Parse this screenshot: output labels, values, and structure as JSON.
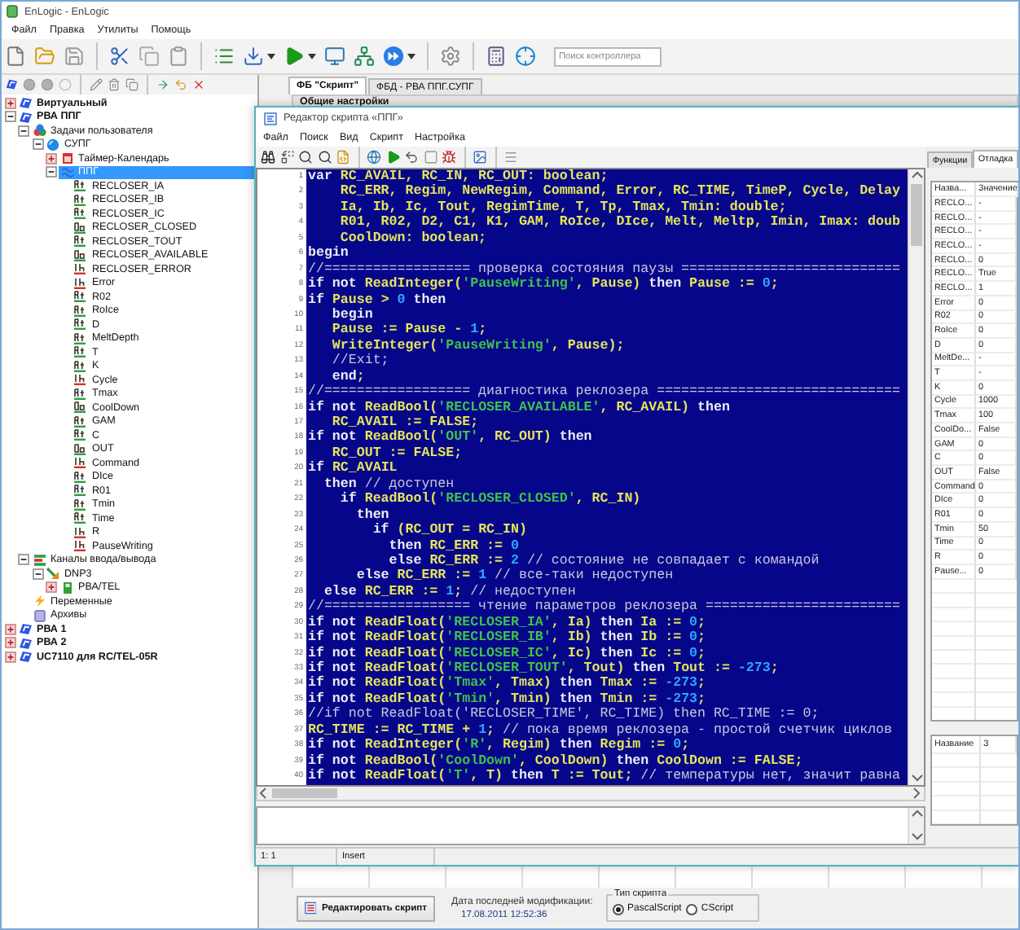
{
  "window": {
    "title": "EnLogic - EnLogic"
  },
  "menu": [
    "Файл",
    "Правка",
    "Утилиты",
    "Помощь"
  ],
  "toolbar": {
    "search": {
      "placeholder": "Поиск контроллера"
    }
  },
  "tree": [
    {
      "label": "Виртуальный",
      "kind": "controller",
      "expanded": false,
      "selected": false
    },
    {
      "label": "РВА ППГ",
      "kind": "controller",
      "expanded": true,
      "selected": false,
      "children": [
        {
          "label": "Задачи пользователя",
          "kind": "tasks",
          "expanded": true,
          "selected": false,
          "children": [
            {
              "label": "СУПГ",
              "kind": "group",
              "expanded": true,
              "selected": false,
              "children": [
                {
                  "label": "Таймер-Календарь",
                  "kind": "timer",
                  "expanded": false,
                  "selected": false
                },
                {
                  "label": "ППГ",
                  "kind": "script",
                  "expanded": true,
                  "selected": true,
                  "children": [
                    {
                      "label": "RECLOSER_IA",
                      "kind": "real",
                      "selected": false
                    },
                    {
                      "label": "RECLOSER_IB",
                      "kind": "real",
                      "selected": false
                    },
                    {
                      "label": "RECLOSER_IC",
                      "kind": "real",
                      "selected": false
                    },
                    {
                      "label": "RECLOSER_CLOSED",
                      "kind": "bool",
                      "selected": false
                    },
                    {
                      "label": "RECLOSER_TOUT",
                      "kind": "real",
                      "selected": false
                    },
                    {
                      "label": "RECLOSER_AVAILABLE",
                      "kind": "bool",
                      "selected": false
                    },
                    {
                      "label": "RECLOSER_ERROR",
                      "kind": "int",
                      "selected": false
                    },
                    {
                      "label": "Error",
                      "kind": "int",
                      "selected": false
                    },
                    {
                      "label": "R02",
                      "kind": "real",
                      "selected": false
                    },
                    {
                      "label": "RoIce",
                      "kind": "real",
                      "selected": false
                    },
                    {
                      "label": "D",
                      "kind": "real",
                      "selected": false
                    },
                    {
                      "label": "MeltDepth",
                      "kind": "real",
                      "selected": false
                    },
                    {
                      "label": "T",
                      "kind": "real",
                      "selected": false
                    },
                    {
                      "label": "K",
                      "kind": "real",
                      "selected": false
                    },
                    {
                      "label": "Cycle",
                      "kind": "int",
                      "selected": false
                    },
                    {
                      "label": "Tmax",
                      "kind": "real",
                      "selected": false
                    },
                    {
                      "label": "CoolDown",
                      "kind": "bool",
                      "selected": false
                    },
                    {
                      "label": "GAM",
                      "kind": "real",
                      "selected": false
                    },
                    {
                      "label": "C",
                      "kind": "real",
                      "selected": false
                    },
                    {
                      "label": "OUT",
                      "kind": "bool",
                      "selected": false
                    },
                    {
                      "label": "Command",
                      "kind": "int",
                      "selected": false
                    },
                    {
                      "label": "DIce",
                      "kind": "real",
                      "selected": false
                    },
                    {
                      "label": "R01",
                      "kind": "real",
                      "selected": false
                    },
                    {
                      "label": "Tmin",
                      "kind": "real",
                      "selected": false
                    },
                    {
                      "label": "Time",
                      "kind": "real",
                      "selected": false
                    },
                    {
                      "label": "R",
                      "kind": "int",
                      "selected": false
                    },
                    {
                      "label": "PauseWriting",
                      "kind": "int",
                      "selected": false
                    }
                  ]
                }
              ]
            }
          ]
        },
        {
          "label": "Каналы ввода/вывода",
          "kind": "channels",
          "expanded": true,
          "selected": false,
          "children": [
            {
              "label": "DNP3",
              "kind": "protocol",
              "expanded": true,
              "selected": false,
              "children": [
                {
                  "label": "РВА/TEL",
                  "kind": "device",
                  "expanded": false,
                  "selected": false
                }
              ]
            }
          ]
        },
        {
          "label": "Переменные",
          "kind": "variables",
          "selected": false
        },
        {
          "label": "Архивы",
          "kind": "archives",
          "selected": false
        }
      ]
    },
    {
      "label": "РВА 1",
      "kind": "controller",
      "expanded": false,
      "selected": false
    },
    {
      "label": "РВА 2",
      "kind": "controller",
      "expanded": false,
      "selected": false
    },
    {
      "label": "UC7110 для RC/TEL-05R",
      "kind": "controller",
      "expanded": false,
      "selected": false
    }
  ],
  "tabs": [
    {
      "label": "ФБ \"Скрипт\"",
      "selected": true
    },
    {
      "label": "ФБД - РВА ППГ.СУПГ",
      "selected": false
    }
  ],
  "section": {
    "title": "Общие настройки"
  },
  "editor": {
    "title": "Редактор скрипта «ППГ»",
    "menu": [
      "Файл",
      "Поиск",
      "Вид",
      "Скрипт",
      "Настройка"
    ],
    "code_lines": [
      {
        "number": "1",
        "tokens": [
          {
            "kind": "kw",
            "text": "var"
          },
          {
            "kind": "id",
            "text": " RC_AVAIL, RC_IN, RC_OUT: boolean;"
          }
        ]
      },
      {
        "number": "2",
        "tokens": [
          {
            "kind": "id",
            "text": "    RC_ERR, Regim, NewRegim, Command, Error, RC_TIME, TimeP, Cycle, Delay"
          }
        ]
      },
      {
        "number": "3",
        "tokens": [
          {
            "kind": "id",
            "text": "    Ia, Ib, Ic, Tout, RegimTime, T, Tp, Tmax, Tmin: double;"
          }
        ]
      },
      {
        "number": "4",
        "tokens": [
          {
            "kind": "id",
            "text": "    R01, R02, D2, C1, K1, GAM, RoIce, DIce, Melt, Meltp, Imin, Imax: doub"
          }
        ]
      },
      {
        "number": "5",
        "tokens": [
          {
            "kind": "id",
            "text": "    CoolDown: boolean;"
          }
        ]
      },
      {
        "number": "6",
        "tokens": [
          {
            "kind": "kw",
            "text": "begin"
          }
        ]
      },
      {
        "number": "7",
        "tokens": [
          {
            "kind": "cmt",
            "text": "//================== проверка состояния паузы ==========================="
          }
        ]
      },
      {
        "number": "8",
        "tokens": [
          {
            "kind": "kw",
            "text": "if not"
          },
          {
            "kind": "id",
            "text": " ReadInteger("
          },
          {
            "kind": "str",
            "text": "'PauseWriting'"
          },
          {
            "kind": "id",
            "text": ", Pause) "
          },
          {
            "kind": "kw",
            "text": "then"
          },
          {
            "kind": "id",
            "text": " Pause := "
          },
          {
            "kind": "num",
            "text": "0"
          },
          {
            "kind": "id",
            "text": ";"
          }
        ]
      },
      {
        "number": "9",
        "tokens": [
          {
            "kind": "kw",
            "text": "if"
          },
          {
            "kind": "id",
            "text": " Pause > "
          },
          {
            "kind": "num",
            "text": "0"
          },
          {
            "kind": "kw",
            "text": " then"
          }
        ]
      },
      {
        "number": "10",
        "tokens": [
          {
            "kind": "kw",
            "text": "   begin"
          }
        ]
      },
      {
        "number": "11",
        "tokens": [
          {
            "kind": "id",
            "text": "   Pause := Pause - "
          },
          {
            "kind": "num",
            "text": "1"
          },
          {
            "kind": "id",
            "text": ";"
          }
        ]
      },
      {
        "number": "12",
        "tokens": [
          {
            "kind": "id",
            "text": "   WriteInteger("
          },
          {
            "kind": "str",
            "text": "'PauseWriting'"
          },
          {
            "kind": "id",
            "text": ", Pause);"
          }
        ]
      },
      {
        "number": "13",
        "tokens": [
          {
            "kind": "cmt",
            "text": "   //Exit;"
          }
        ]
      },
      {
        "number": "14",
        "tokens": [
          {
            "kind": "kw",
            "text": "   end"
          },
          {
            "kind": "id",
            "text": ";"
          }
        ]
      },
      {
        "number": "15",
        "tokens": [
          {
            "kind": "cmt",
            "text": "//================== диагностика реклозера =============================="
          }
        ]
      },
      {
        "number": "16",
        "tokens": [
          {
            "kind": "kw",
            "text": "if not"
          },
          {
            "kind": "id",
            "text": " ReadBool("
          },
          {
            "kind": "str",
            "text": "'RECLOSER_AVAILABLE'"
          },
          {
            "kind": "id",
            "text": ", RC_AVAIL) "
          },
          {
            "kind": "kw",
            "text": "then"
          }
        ]
      },
      {
        "number": "17",
        "tokens": [
          {
            "kind": "id",
            "text": "   RC_AVAIL := FALSE;"
          }
        ]
      },
      {
        "number": "18",
        "tokens": [
          {
            "kind": "kw",
            "text": "if not"
          },
          {
            "kind": "id",
            "text": " ReadBool("
          },
          {
            "kind": "str",
            "text": "'OUT'"
          },
          {
            "kind": "id",
            "text": ", RC_OUT) "
          },
          {
            "kind": "kw",
            "text": "then"
          }
        ]
      },
      {
        "number": "19",
        "tokens": [
          {
            "kind": "id",
            "text": "   RC_OUT := FALSE;"
          }
        ]
      },
      {
        "number": "20",
        "tokens": [
          {
            "kind": "kw",
            "text": "if"
          },
          {
            "kind": "id",
            "text": " RC_AVAIL"
          }
        ]
      },
      {
        "number": "21",
        "tokens": [
          {
            "kind": "kw",
            "text": "  then"
          },
          {
            "kind": "cmt",
            "text": " // доступен"
          }
        ]
      },
      {
        "number": "22",
        "tokens": [
          {
            "kind": "kw",
            "text": "    if"
          },
          {
            "kind": "id",
            "text": " ReadBool("
          },
          {
            "kind": "str",
            "text": "'RECLOSER_CLOSED'"
          },
          {
            "kind": "id",
            "text": ", RC_IN)"
          }
        ]
      },
      {
        "number": "23",
        "tokens": [
          {
            "kind": "kw",
            "text": "      then"
          }
        ]
      },
      {
        "number": "24",
        "tokens": [
          {
            "kind": "kw",
            "text": "        if"
          },
          {
            "kind": "id",
            "text": " (RC_OUT = RC_IN)"
          }
        ]
      },
      {
        "number": "25",
        "tokens": [
          {
            "kind": "kw",
            "text": "          then"
          },
          {
            "kind": "id",
            "text": " RC_ERR := "
          },
          {
            "kind": "num",
            "text": "0"
          }
        ]
      },
      {
        "number": "26",
        "tokens": [
          {
            "kind": "kw",
            "text": "          else"
          },
          {
            "kind": "id",
            "text": " RC_ERR := "
          },
          {
            "kind": "num",
            "text": "2"
          },
          {
            "kind": "cmt",
            "text": " // состояние не совпадает с командой"
          }
        ]
      },
      {
        "number": "27",
        "tokens": [
          {
            "kind": "kw",
            "text": "      else"
          },
          {
            "kind": "id",
            "text": " RC_ERR := "
          },
          {
            "kind": "num",
            "text": "1"
          },
          {
            "kind": "cmt",
            "text": " // все-таки недоступен"
          }
        ]
      },
      {
        "number": "28",
        "tokens": [
          {
            "kind": "kw",
            "text": "  else"
          },
          {
            "kind": "id",
            "text": " RC_ERR := "
          },
          {
            "kind": "num",
            "text": "1"
          },
          {
            "kind": "id",
            "text": ";"
          },
          {
            "kind": "cmt",
            "text": " // недоступен"
          }
        ]
      },
      {
        "number": "29",
        "tokens": [
          {
            "kind": "cmt",
            "text": "//================== чтение параметров реклозера ========================"
          }
        ]
      },
      {
        "number": "30",
        "tokens": [
          {
            "kind": "kw",
            "text": "if not"
          },
          {
            "kind": "id",
            "text": " ReadFloat("
          },
          {
            "kind": "str",
            "text": "'RECLOSER_IA'"
          },
          {
            "kind": "id",
            "text": ", Ia) "
          },
          {
            "kind": "kw",
            "text": "then"
          },
          {
            "kind": "id",
            "text": " Ia := "
          },
          {
            "kind": "num",
            "text": "0"
          },
          {
            "kind": "id",
            "text": ";"
          }
        ]
      },
      {
        "number": "31",
        "tokens": [
          {
            "kind": "kw",
            "text": "if not"
          },
          {
            "kind": "id",
            "text": " ReadFloat("
          },
          {
            "kind": "str",
            "text": "'RECLOSER_IB'"
          },
          {
            "kind": "id",
            "text": ", Ib) "
          },
          {
            "kind": "kw",
            "text": "then"
          },
          {
            "kind": "id",
            "text": " Ib := "
          },
          {
            "kind": "num",
            "text": "0"
          },
          {
            "kind": "id",
            "text": ";"
          }
        ]
      },
      {
        "number": "32",
        "tokens": [
          {
            "kind": "kw",
            "text": "if not"
          },
          {
            "kind": "id",
            "text": " ReadFloat("
          },
          {
            "kind": "str",
            "text": "'RECLOSER_IC'"
          },
          {
            "kind": "id",
            "text": ", Ic) "
          },
          {
            "kind": "kw",
            "text": "then"
          },
          {
            "kind": "id",
            "text": " Ic := "
          },
          {
            "kind": "num",
            "text": "0"
          },
          {
            "kind": "id",
            "text": ";"
          }
        ]
      },
      {
        "number": "33",
        "tokens": [
          {
            "kind": "kw",
            "text": "if not"
          },
          {
            "kind": "id",
            "text": " ReadFloat("
          },
          {
            "kind": "str",
            "text": "'RECLOSER_TOUT'"
          },
          {
            "kind": "id",
            "text": ", Tout) "
          },
          {
            "kind": "kw",
            "text": "then"
          },
          {
            "kind": "id",
            "text": " Tout := "
          },
          {
            "kind": "num",
            "text": "-273"
          },
          {
            "kind": "id",
            "text": ";"
          }
        ]
      },
      {
        "number": "34",
        "tokens": [
          {
            "kind": "kw",
            "text": "if not"
          },
          {
            "kind": "id",
            "text": " ReadFloat("
          },
          {
            "kind": "str",
            "text": "'Tmax'"
          },
          {
            "kind": "id",
            "text": ", Tmax) "
          },
          {
            "kind": "kw",
            "text": "then"
          },
          {
            "kind": "id",
            "text": " Tmax := "
          },
          {
            "kind": "num",
            "text": "-273"
          },
          {
            "kind": "id",
            "text": ";"
          }
        ]
      },
      {
        "number": "35",
        "tokens": [
          {
            "kind": "kw",
            "text": "if not"
          },
          {
            "kind": "id",
            "text": " ReadFloat("
          },
          {
            "kind": "str",
            "text": "'Tmin'"
          },
          {
            "kind": "id",
            "text": ", Tmin) "
          },
          {
            "kind": "kw",
            "text": "then"
          },
          {
            "kind": "id",
            "text": " Tmin := "
          },
          {
            "kind": "num",
            "text": "-273"
          },
          {
            "kind": "id",
            "text": ";"
          }
        ]
      },
      {
        "number": "36",
        "tokens": [
          {
            "kind": "cmt",
            "text": "//if not ReadFloat('RECLOSER_TIME', RC_TIME) then RC_TIME := 0;"
          }
        ]
      },
      {
        "number": "37",
        "tokens": [
          {
            "kind": "id",
            "text": "RC_TIME := RC_TIME + "
          },
          {
            "kind": "num",
            "text": "1"
          },
          {
            "kind": "id",
            "text": ";"
          },
          {
            "kind": "cmt",
            "text": " // пока время реклозера - простой счетчик циклов"
          }
        ]
      },
      {
        "number": "38",
        "tokens": [
          {
            "kind": "kw",
            "text": "if not"
          },
          {
            "kind": "id",
            "text": " ReadInteger("
          },
          {
            "kind": "str",
            "text": "'R'"
          },
          {
            "kind": "id",
            "text": ", Regim) "
          },
          {
            "kind": "kw",
            "text": "then"
          },
          {
            "kind": "id",
            "text": " Regim := "
          },
          {
            "kind": "num",
            "text": "0"
          },
          {
            "kind": "id",
            "text": ";"
          }
        ]
      },
      {
        "number": "39",
        "tokens": [
          {
            "kind": "kw",
            "text": "if not"
          },
          {
            "kind": "id",
            "text": " ReadBool("
          },
          {
            "kind": "str",
            "text": "'CoolDown'"
          },
          {
            "kind": "id",
            "text": ", CoolDown) "
          },
          {
            "kind": "kw",
            "text": "then"
          },
          {
            "kind": "id",
            "text": " CoolDown := FALSE;"
          }
        ]
      },
      {
        "number": "40",
        "tokens": [
          {
            "kind": "kw",
            "text": "if not"
          },
          {
            "kind": "id",
            "text": " ReadFloat("
          },
          {
            "kind": "str",
            "text": "'T'"
          },
          {
            "kind": "id",
            "text": ", T) "
          },
          {
            "kind": "kw",
            "text": "then"
          },
          {
            "kind": "id",
            "text": " T := Tout;"
          },
          {
            "kind": "cmt",
            "text": " // температуры нет, значит равна"
          }
        ]
      }
    ],
    "side_tabs": [
      {
        "label": "Функции",
        "selected": false
      },
      {
        "label": "Отладка",
        "selected": true
      }
    ],
    "watch_table": {
      "columns": [
        "Назва...",
        "Значение"
      ],
      "rows": [
        [
          "RECLO...",
          "-"
        ],
        [
          "RECLO...",
          "-"
        ],
        [
          "RECLO...",
          "-"
        ],
        [
          "RECLO...",
          "-"
        ],
        [
          "RECLO...",
          "0"
        ],
        [
          "RECLO...",
          "True"
        ],
        [
          "RECLO...",
          "1"
        ],
        [
          "Error",
          "0"
        ],
        [
          "R02",
          "0"
        ],
        [
          "RoIce",
          "0"
        ],
        [
          "D",
          "0"
        ],
        [
          "MeltDe...",
          "-"
        ],
        [
          "T",
          "-"
        ],
        [
          "K",
          "0"
        ],
        [
          "Cycle",
          "1000"
        ],
        [
          "Tmax",
          "100"
        ],
        [
          "CoolDo...",
          "False"
        ],
        [
          "GAM",
          "0"
        ],
        [
          "C",
          "0"
        ],
        [
          "OUT",
          "False"
        ],
        [
          "Command",
          "0"
        ],
        [
          "DIce",
          "0"
        ],
        [
          "R01",
          "0"
        ],
        [
          "Tmin",
          "50"
        ],
        [
          "Time",
          "0"
        ],
        [
          "R",
          "0"
        ],
        [
          "Pause...",
          "0"
        ]
      ]
    },
    "lower_table": {
      "columns": [
        "Название",
        "З"
      ]
    },
    "status": {
      "position": "1: 1",
      "mode": "Insert"
    }
  },
  "footer": {
    "edit_button": "Редактировать скрипт",
    "modified_label": "Дата последней модификации:",
    "modified_value": "17.08.2011 12:52:36",
    "script_type": {
      "title": "Тип скрипта",
      "options": [
        {
          "label": "PascalScript",
          "selected": true
        },
        {
          "label": "CScript",
          "selected": false
        }
      ]
    }
  }
}
